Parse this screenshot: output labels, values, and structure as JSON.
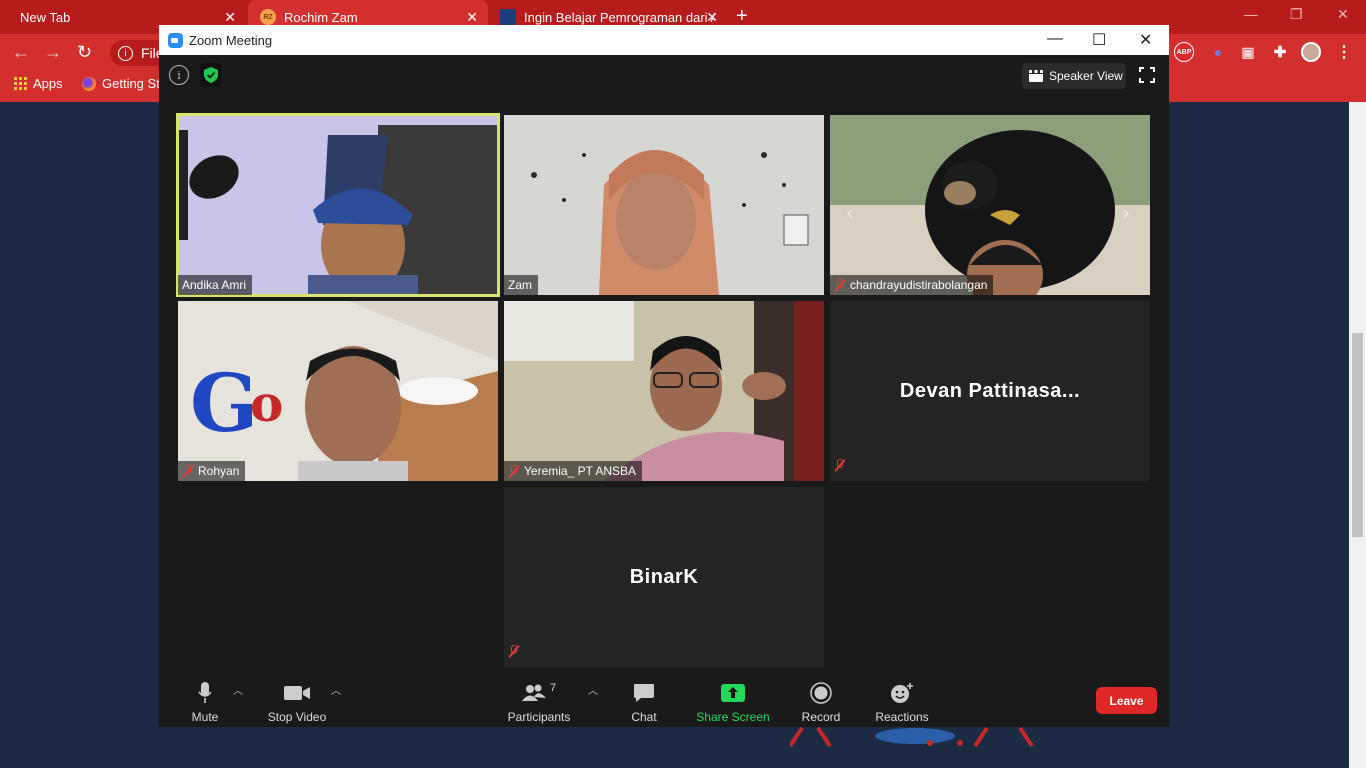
{
  "browser": {
    "tabs": [
      {
        "label": "New Tab"
      },
      {
        "label": "Rochim Zam",
        "favicon": "RZ"
      },
      {
        "label": "Ingin Belajar Pemrograman dari A"
      }
    ],
    "address_text": "File",
    "bookmarks": {
      "apps": "Apps",
      "getting_started": "Getting St"
    },
    "ext_abp": "ABP",
    "accent": "#d32f2f"
  },
  "zoom": {
    "title": "Zoom Meeting",
    "speaker_view_label": "Speaker View",
    "participants_grid": [
      {
        "name": "Andika Amri",
        "muted": false,
        "speaking": true
      },
      {
        "name": "Zam",
        "muted": false,
        "speaking": false
      },
      {
        "name": "chandrayudistirabolangan",
        "muted": true,
        "speaking": false
      },
      {
        "name": "Rohyan",
        "muted": true,
        "speaking": false
      },
      {
        "name": "Yeremia_ PT ANSBA",
        "muted": true,
        "speaking": false
      },
      {
        "name": "Devan Pattinasa...",
        "muted": true,
        "video": false
      },
      {
        "name": "BinarK",
        "muted": true,
        "video": false
      }
    ],
    "controls": {
      "mute": "Mute",
      "stop_video": "Stop Video",
      "participants": "Participants",
      "participants_count": "7",
      "chat": "Chat",
      "share_screen": "Share Screen",
      "record": "Record",
      "reactions": "Reactions",
      "leave": "Leave"
    },
    "colors": {
      "share": "#23d959",
      "leave": "#e02828",
      "speaking_border": "#d7e46b"
    }
  }
}
